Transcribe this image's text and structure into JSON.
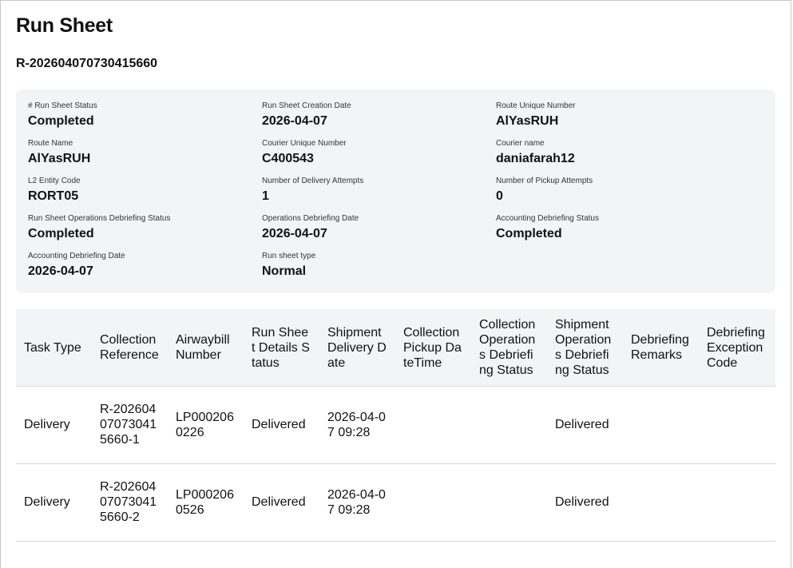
{
  "page": {
    "title": "Run Sheet",
    "run_sheet_id": "R-202604070730415660"
  },
  "summary": [
    {
      "label": "# Run Sheet Status",
      "value": "Completed"
    },
    {
      "label": "Run Sheet Creation Date",
      "value": "2026-04-07"
    },
    {
      "label": "Route Unique Number",
      "value": "AlYasRUH"
    },
    {
      "label": "Route Name",
      "value": "AlYasRUH"
    },
    {
      "label": "Courier Unique Number",
      "value": "C400543"
    },
    {
      "label": "Courier name",
      "value": "daniafarah12"
    },
    {
      "label": "L2 Entity Code",
      "value": "RORT05"
    },
    {
      "label": "Number of Delivery Attempts",
      "value": "1"
    },
    {
      "label": "Number of Pickup Attempts",
      "value": "0"
    },
    {
      "label": "Run Sheet Operations Debriefing Status",
      "value": "Completed"
    },
    {
      "label": "Operations Debriefing Date",
      "value": "2026-04-07"
    },
    {
      "label": "Accounting Debriefing Status",
      "value": "Completed"
    },
    {
      "label": "Accounting Debriefing Date",
      "value": "2026-04-07"
    },
    {
      "label": "Run sheet type",
      "value": "Normal"
    }
  ],
  "table": {
    "headers": [
      "Task Type",
      "Collection Reference",
      "Airwaybill Number",
      "Run Sheet Details Status",
      "Shipment Delivery Date",
      "Collection Pickup DateTime",
      "Collection Operations Debriefing Status",
      "Shipment Operations Debriefing Status",
      "Debriefing Remarks",
      "Debriefing Exception Code"
    ],
    "rows": [
      [
        "Delivery",
        "R-202604070730415660-1",
        "LP0002060226",
        "Delivered",
        "2026-04-07 09:28",
        "",
        "",
        "Delivered",
        "",
        ""
      ],
      [
        "Delivery",
        "R-202604070730415660-2",
        "LP0002060526",
        "Delivered",
        "2026-04-07 09:28",
        "",
        "",
        "Delivered",
        "",
        ""
      ]
    ]
  }
}
